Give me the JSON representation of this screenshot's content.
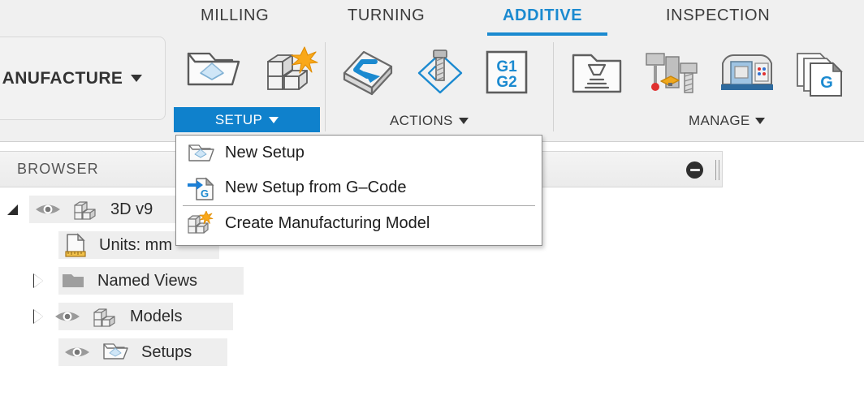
{
  "app": {
    "workspace_button": {
      "label": "ANUFACTURE",
      "caret_icon": "caret-down-icon"
    }
  },
  "ribbon": {
    "tabs": [
      {
        "label": "MILLING",
        "active": false
      },
      {
        "label": "TURNING",
        "active": false
      },
      {
        "label": "ADDITIVE",
        "active": true
      },
      {
        "label": "INSPECTION",
        "active": false
      }
    ],
    "groups": [
      {
        "name": "SETUP",
        "label": "SETUP",
        "active": true,
        "caret_icon": "caret-down-icon",
        "icons": [
          {
            "name": "new-setup-icon",
            "tooltip": "New Setup"
          },
          {
            "name": "create-manufacturing-model-icon",
            "tooltip": "Create Manufacturing Model"
          }
        ]
      },
      {
        "name": "ACTIONS",
        "label": "ACTIONS",
        "active": false,
        "caret_icon": "caret-down-icon",
        "icons": [
          {
            "name": "additive-toolpath-icon",
            "tooltip": "Additive Toolpath"
          },
          {
            "name": "probe-icon",
            "tooltip": "Probe"
          },
          {
            "name": "g1-g2-icon",
            "tooltip": "G1 G2",
            "text": "G1\nG2"
          }
        ]
      },
      {
        "name": "MANAGE",
        "label": "MANAGE",
        "active": false,
        "caret_icon": "caret-down-icon",
        "icons": [
          {
            "name": "tool-library-icon",
            "tooltip": "Tool Library"
          },
          {
            "name": "machining-tools-icon",
            "tooltip": "Machining Tools"
          },
          {
            "name": "machine-library-icon",
            "tooltip": "Machine Library"
          },
          {
            "name": "post-process-icon",
            "tooltip": "Post Process",
            "text": "G"
          },
          {
            "name": "nc-programs-icon",
            "tooltip": "NC Programs"
          }
        ]
      }
    ]
  },
  "setup_menu": {
    "items": [
      {
        "label": "New Setup",
        "icon": "new-setup-folder-icon",
        "separator_after": false
      },
      {
        "label": "New Setup from G–Code",
        "icon": "new-setup-from-gcode-icon",
        "separator_after": true
      },
      {
        "label": "Create Manufacturing Model",
        "icon": "create-manufacturing-model-icon",
        "separator_after": false
      }
    ]
  },
  "browser": {
    "title": "BROWSER",
    "collapse_icon": "collapse-icon",
    "drag_handle_icon": "drag-handle-icon",
    "tree": [
      {
        "label": "3D v9",
        "indent": 0,
        "expander": "triangle-down-filled-icon",
        "visibility_icon": "eye-icon",
        "type_icon": "document-model-icon",
        "highlighted": true
      },
      {
        "label": "Units: mm",
        "indent": 1,
        "expander": "none",
        "visibility_icon": "none",
        "type_icon": "units-ruler-icon",
        "highlighted": true
      },
      {
        "label": "Named Views",
        "indent": 1,
        "expander": "triangle-right-icon",
        "visibility_icon": "none",
        "type_icon": "folder-icon",
        "highlighted": true
      },
      {
        "label": "Models",
        "indent": 1,
        "expander": "triangle-right-icon",
        "visibility_icon": "eye-icon",
        "type_icon": "document-model-icon",
        "highlighted": true
      },
      {
        "label": "Setups",
        "indent": 1,
        "expander": "none",
        "visibility_icon": "eye-icon",
        "type_icon": "setup-folder-icon",
        "highlighted": true
      }
    ]
  },
  "colors": {
    "accent_blue": "#1b8ad0",
    "setup_button_blue": "#0f81cc",
    "ribbon_bg": "#f0f0f0",
    "row_highlight": "#eeeeee",
    "text_dark": "#2a2a2a",
    "icon_gold": "#f5a81c"
  }
}
